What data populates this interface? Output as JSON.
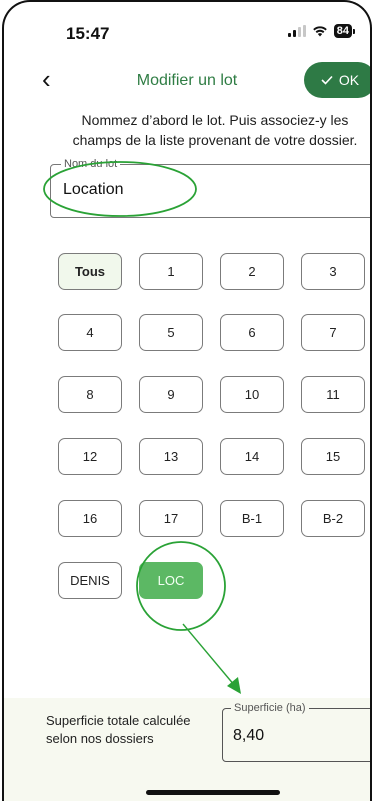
{
  "status_bar": {
    "time": "15:47",
    "battery": "84"
  },
  "header": {
    "title": "Modifier un lot",
    "ok_label": "OK"
  },
  "instructions": "Nommez d’abord le lot. Puis associez-y les champs de la liste provenant de votre dossier.",
  "lot_name": {
    "legend": "Nom du lot",
    "value": "Location"
  },
  "chips": [
    "Tous",
    "1",
    "2",
    "3",
    "4",
    "5",
    "6",
    "7",
    "8",
    "9",
    "10",
    "11",
    "12",
    "13",
    "14",
    "15",
    "16",
    "17",
    "B-1",
    "B-2",
    "DENIS",
    "LOC"
  ],
  "selected_chip": "LOC",
  "summary": {
    "label": "Superficie totale calculée selon nos dossiers",
    "legend": "Superficie (ha)",
    "value": "8,40"
  },
  "colors": {
    "accent": "#2e7a45",
    "selected": "#5cb864",
    "annotation": "#2aa236"
  }
}
